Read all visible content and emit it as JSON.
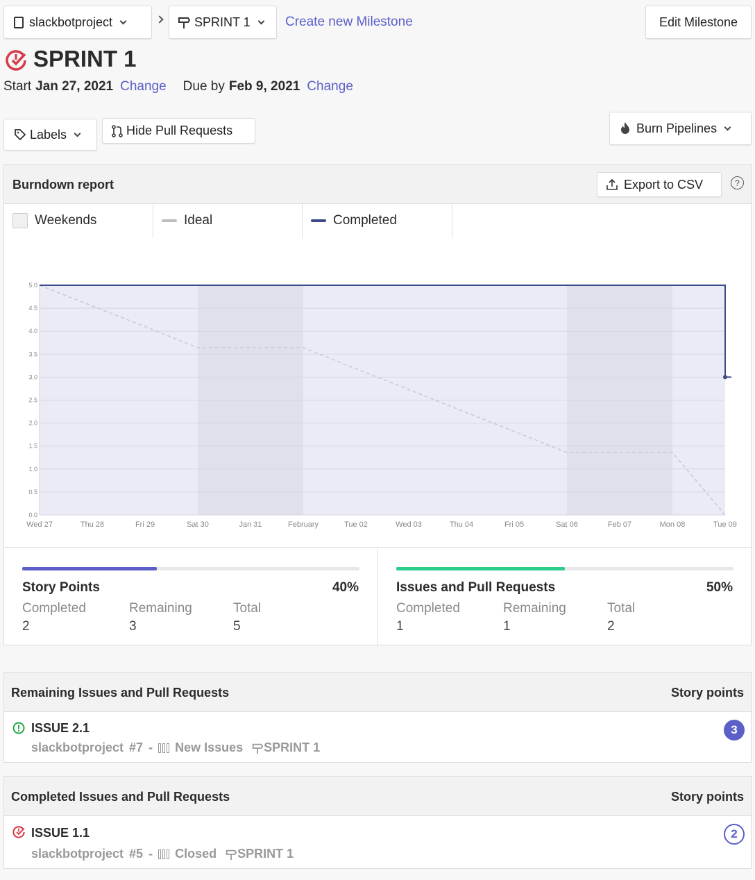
{
  "topbar": {
    "repo": "slackbotproject",
    "milestone": "SPRINT 1",
    "create_link": "Create new Milestone",
    "edit_button": "Edit Milestone"
  },
  "milestone": {
    "title": "SPRINT 1",
    "start_label": "Start",
    "start_date": "Jan 27, 2021",
    "change1": "Change",
    "due_label": "Due by",
    "due_date": "Feb 9, 2021",
    "change2": "Change"
  },
  "filters": {
    "labels": "Labels",
    "hide_prs": "Hide Pull Requests",
    "burn": "Burn Pipelines"
  },
  "report": {
    "title": "Burndown report",
    "export": "Export to CSV",
    "help": "?",
    "legend": {
      "weekends": "Weekends",
      "ideal": "Ideal",
      "completed": "Completed"
    }
  },
  "chart_data": {
    "type": "line",
    "x": [
      "Wed 27",
      "Thu 28",
      "Fri 29",
      "Sat 30",
      "Jan 31",
      "February",
      "Tue 02",
      "Wed 03",
      "Thu 04",
      "Fri 05",
      "Sat 06",
      "Feb 07",
      "Mon 08",
      "Tue 09"
    ],
    "ylim": [
      0,
      5
    ],
    "yticks": [
      "0.0",
      "0.5",
      "1.0",
      "1.5",
      "2.0",
      "2.5",
      "3.0",
      "3.5",
      "4.0",
      "4.5",
      "5.0"
    ],
    "weekend_bands": [
      [
        "Sat 30",
        "February"
      ],
      [
        "Sat 06",
        "Mon 08"
      ]
    ],
    "series": [
      {
        "name": "Ideal",
        "color": "#c8c8d4",
        "style": "dashed",
        "values": [
          5.0,
          4.55,
          4.1,
          3.64,
          3.64,
          3.64,
          3.18,
          2.73,
          2.27,
          1.82,
          1.36,
          1.36,
          1.36,
          0.0
        ]
      },
      {
        "name": "Completed",
        "color": "#3d4a8a",
        "style": "solid",
        "points": [
          [
            "Wed 27",
            5.0
          ],
          [
            "Tue 09",
            5.0
          ],
          [
            "Tue 09",
            3.0
          ]
        ]
      }
    ],
    "grid": true
  },
  "stats": {
    "story_points": {
      "title": "Story Points",
      "percent": "40%",
      "progress": 0.4,
      "completed_label": "Completed",
      "completed": "2",
      "remaining_label": "Remaining",
      "remaining": "3",
      "total_label": "Total",
      "total": "5",
      "color": "#5b5fc7"
    },
    "issues": {
      "title": "Issues and Pull Requests",
      "percent": "50%",
      "progress": 0.5,
      "completed_label": "Completed",
      "completed": "1",
      "remaining_label": "Remaining",
      "remaining": "1",
      "total_label": "Total",
      "total": "2",
      "color": "#2ecc8b"
    }
  },
  "remaining": {
    "header": "Remaining Issues and Pull Requests",
    "points_header": "Story points",
    "items": [
      {
        "title": "ISSUE 2.1",
        "repo": "slackbotproject",
        "number": "#7",
        "sep": "-",
        "pipeline": "New Issues",
        "milestone": "SPRINT 1",
        "points": "3"
      }
    ]
  },
  "completed": {
    "header": "Completed Issues and Pull Requests",
    "points_header": "Story points",
    "items": [
      {
        "title": "ISSUE 1.1",
        "repo": "slackbotproject",
        "number": "#5",
        "sep": "-",
        "pipeline": "Closed",
        "milestone": "SPRINT 1",
        "points": "2"
      }
    ]
  }
}
